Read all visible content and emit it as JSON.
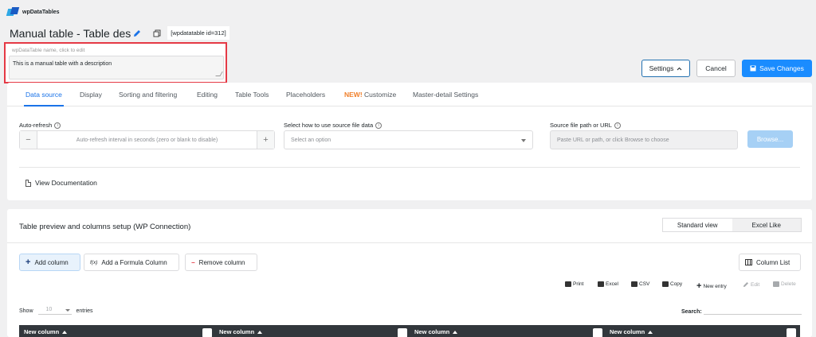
{
  "app": {
    "logo_text": "wpDataTables"
  },
  "header": {
    "title": "Manual table - Table des",
    "shortcode": "[wpdatatable id=312]",
    "name_hint": "wpDataTable name, click to edit",
    "description": "This is a manual table with a description"
  },
  "actions": {
    "settings": "Settings",
    "cancel": "Cancel",
    "save": "Save Changes"
  },
  "tabs": [
    {
      "label": "Data source",
      "active": true
    },
    {
      "label": "Display"
    },
    {
      "label": "Sorting and filtering"
    },
    {
      "label": "Editing"
    },
    {
      "label": "Table Tools"
    },
    {
      "label": "Placeholders"
    },
    {
      "badge": "NEW!",
      "label": "Customize"
    },
    {
      "label": "Master-detail Settings"
    }
  ],
  "data_source": {
    "auto_refresh_label": "Auto-refresh",
    "auto_refresh_placeholder": "Auto-refresh interval in seconds (zero or blank to disable)",
    "source_use_label": "Select how to use source file data",
    "source_use_placeholder": "Select an option",
    "path_label": "Source file path or URL",
    "path_placeholder": "Paste URL or path, or click Browse to choose",
    "browse": "Browse...",
    "view_doc": "View Documentation"
  },
  "preview": {
    "title": "Table preview and columns setup (WP Connection)",
    "standard_view": "Standard view",
    "excel_like": "Excel Like",
    "add_column": "Add column",
    "add_formula": "Add a Formula Column",
    "fx": "f(x)",
    "remove_column": "Remove column",
    "column_list": "Column List",
    "toolbar": {
      "print": "Print",
      "excel": "Excel",
      "csv": "CSV",
      "copy": "Copy",
      "new_entry": "New entry",
      "edit": "Edit",
      "delete": "Delete"
    },
    "show": "Show",
    "entries_value": "10",
    "entries": "entries",
    "search": "Search:",
    "columns": [
      "New column",
      "New column",
      "New column",
      "New column"
    ]
  }
}
